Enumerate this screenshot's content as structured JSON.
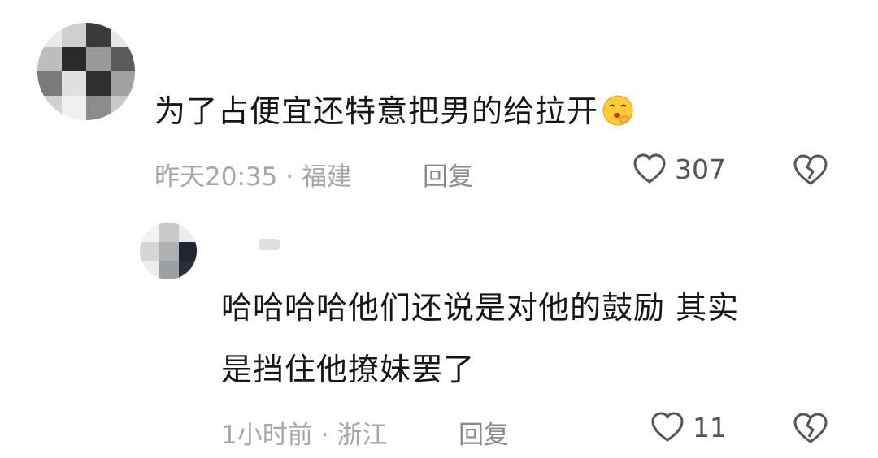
{
  "comments": [
    {
      "text": "为了占便宜还特意把男的给拉开",
      "emoji": "shushing-face-emoji",
      "time": "昨天20:35",
      "location": "福建",
      "meta_separator": " · ",
      "reply_label": "回复",
      "likes": "307"
    },
    {
      "text_line1": "哈哈哈哈他们还说是对他的鼓励 其实",
      "text_line2": "是挡住他撩妹罢了",
      "time": "1小时前",
      "location": "浙江",
      "meta_separator": " · ",
      "reply_label": "回复",
      "likes": "11"
    }
  ],
  "colors": {
    "text": "#161616",
    "meta": "#a7a7a7",
    "reply": "#8a8a8a",
    "icon": "#555555"
  }
}
